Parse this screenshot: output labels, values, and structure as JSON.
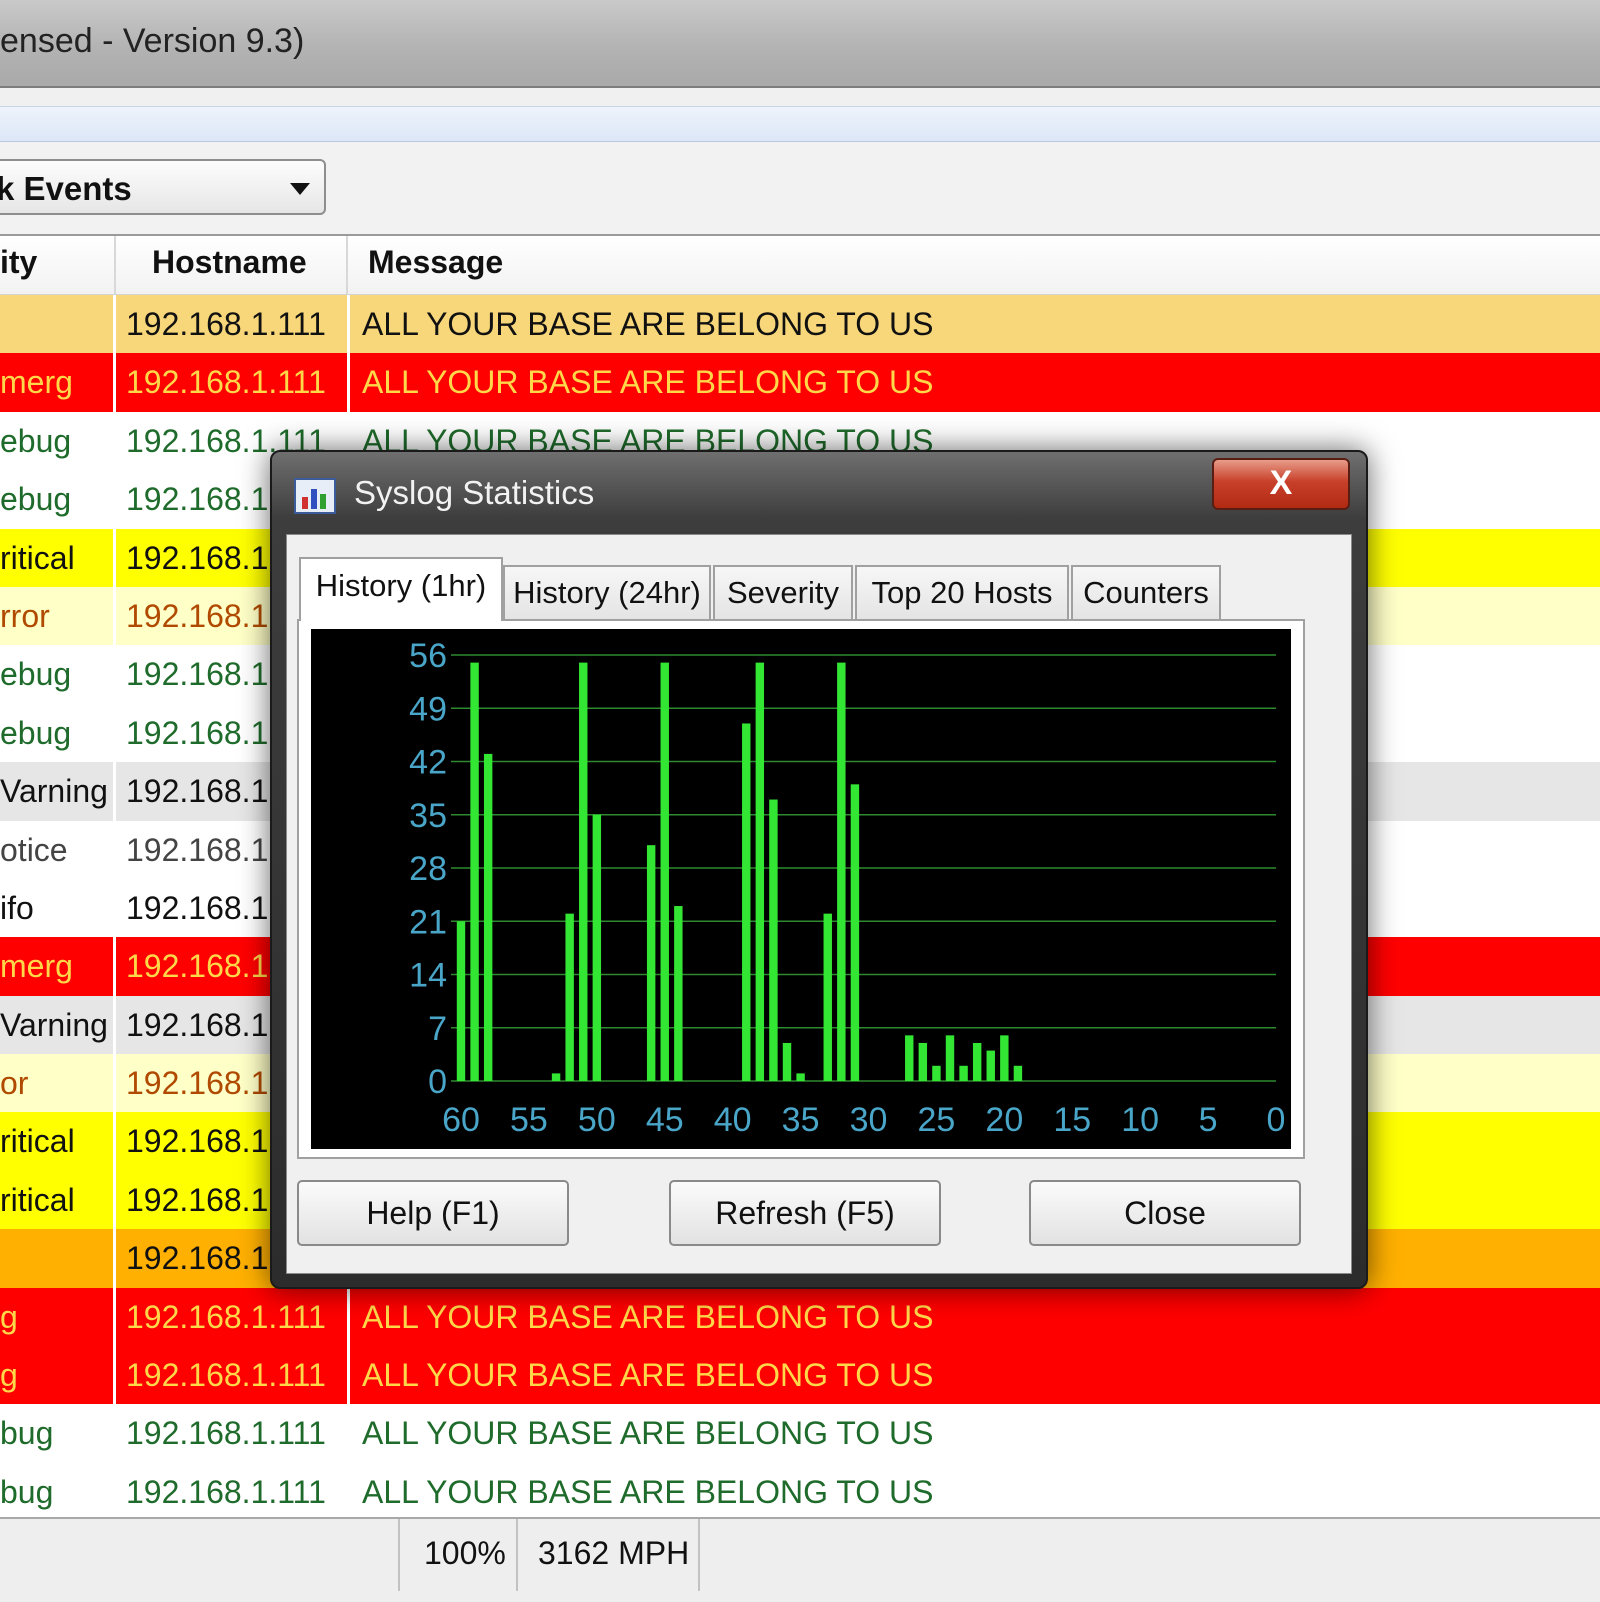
{
  "window": {
    "title": "ensed - Version 9.3)"
  },
  "toolbar": {
    "filter_value": "k Events"
  },
  "grid": {
    "headers": {
      "severity": "ity",
      "hostname": "Hostname",
      "message": "Message"
    },
    "rows": [
      {
        "sev": "",
        "host": "192.168.1.111",
        "msg": "ALL YOUR BASE ARE BELONG TO US",
        "bg": "#f7d77a",
        "fg": "#111111",
        "sevbg": "#f7d77a"
      },
      {
        "sev": "merg",
        "host": "192.168.1.111",
        "msg": "ALL YOUR BASE ARE BELONG TO US",
        "bg": "#ff0000",
        "fg": "#ffd84a",
        "sevbg": "#ff0000"
      },
      {
        "sev": "ebug",
        "host": "192.168.1.111",
        "msg": "ALL YOUR BASE ARE BELONG TO US",
        "bg": "#ffffff",
        "fg": "#1f6b2b",
        "sevbg": "#ffffff"
      },
      {
        "sev": "ebug",
        "host": "192.168.1",
        "msg": "",
        "bg": "#ffffff",
        "fg": "#1f6b2b",
        "sevbg": "#ffffff"
      },
      {
        "sev": "ritical",
        "host": "192.168.1",
        "msg": "",
        "bg": "#ffff00",
        "fg": "#111111",
        "sevbg": "#ffff00"
      },
      {
        "sev": "rror",
        "host": "192.168.1",
        "msg": "",
        "bg": "#ffffc8",
        "fg": "#b04a00",
        "sevbg": "#ffffc8"
      },
      {
        "sev": "ebug",
        "host": "192.168.1",
        "msg": "",
        "bg": "#ffffff",
        "fg": "#1f6b2b",
        "sevbg": "#ffffff"
      },
      {
        "sev": "ebug",
        "host": "192.168.1",
        "msg": "",
        "bg": "#ffffff",
        "fg": "#1f6b2b",
        "sevbg": "#ffffff"
      },
      {
        "sev": "Varning",
        "host": "192.168.1",
        "msg": "",
        "bg": "#e6e6e6",
        "fg": "#111111",
        "sevbg": "#e6e6e6"
      },
      {
        "sev": "otice",
        "host": "192.168.1",
        "msg": "",
        "bg": "#ffffff",
        "fg": "#444444",
        "sevbg": "#ffffff"
      },
      {
        "sev": "ifo",
        "host": "192.168.1",
        "msg": "",
        "bg": "#ffffff",
        "fg": "#111111",
        "sevbg": "#ffffff"
      },
      {
        "sev": "merg",
        "host": "192.168.1",
        "msg": "",
        "bg": "#ff0000",
        "fg": "#ffd84a",
        "sevbg": "#ff0000"
      },
      {
        "sev": "Varning",
        "host": "192.168.1",
        "msg": "",
        "bg": "#e6e6e6",
        "fg": "#111111",
        "sevbg": "#e6e6e6"
      },
      {
        "sev": "or",
        "host": "192.168.1",
        "msg": "",
        "bg": "#ffffc8",
        "fg": "#b04a00",
        "sevbg": "#ffffc8"
      },
      {
        "sev": "ritical",
        "host": "192.168.1",
        "msg": "",
        "bg": "#ffff00",
        "fg": "#111111",
        "sevbg": "#ffff00"
      },
      {
        "sev": "ritical",
        "host": "192.168.1",
        "msg": "",
        "bg": "#ffff00",
        "fg": "#111111",
        "sevbg": "#ffff00"
      },
      {
        "sev": "",
        "host": "192.168.1",
        "msg": "",
        "bg": "#ffb000",
        "fg": "#111111",
        "sevbg": "#ffb000"
      },
      {
        "sev": "g",
        "host": "192.168.1.111",
        "msg": "ALL YOUR BASE ARE BELONG TO US",
        "bg": "#ff0000",
        "fg": "#ffd84a",
        "sevbg": "#ff0000"
      },
      {
        "sev": "g",
        "host": "192.168.1.111",
        "msg": "ALL YOUR BASE ARE BELONG TO US",
        "bg": "#ff0000",
        "fg": "#ffd84a",
        "sevbg": "#ff0000"
      },
      {
        "sev": "bug",
        "host": "192.168.1.111",
        "msg": "ALL YOUR BASE ARE BELONG TO US",
        "bg": "#ffffff",
        "fg": "#1f6b2b",
        "sevbg": "#ffffff"
      },
      {
        "sev": "bug",
        "host": "192.168.1.111",
        "msg": "ALL YOUR BASE ARE BELONG TO US",
        "bg": "#ffffff",
        "fg": "#1f6b2b",
        "sevbg": "#ffffff"
      }
    ]
  },
  "statusbar": {
    "percent": "100%",
    "rate": "3162 MPH"
  },
  "dialog": {
    "title": "Syslog Statistics",
    "close_glyph": "X",
    "tabs": [
      "History (1hr)",
      "History (24hr)",
      "Severity",
      "Top 20 Hosts",
      "Counters"
    ],
    "active_tab": 0,
    "buttons": {
      "help": "Help (F1)",
      "refresh": "Refresh (F5)",
      "close": "Close"
    }
  },
  "chart_data": {
    "type": "bar",
    "x_ticks": [
      60,
      55,
      50,
      45,
      40,
      35,
      30,
      25,
      20,
      15,
      10,
      5,
      0
    ],
    "y_ticks": [
      0,
      7,
      14,
      21,
      28,
      35,
      42,
      49,
      56
    ],
    "ylim": [
      0,
      56
    ],
    "xlim": [
      60,
      0
    ],
    "grid": true,
    "bar_color": "#33e633",
    "background": "#000000",
    "tick_color": "#4aa6c8",
    "values": [
      {
        "x": 60,
        "y": 21
      },
      {
        "x": 59,
        "y": 55
      },
      {
        "x": 58,
        "y": 43
      },
      {
        "x": 53,
        "y": 1
      },
      {
        "x": 52,
        "y": 22
      },
      {
        "x": 51,
        "y": 55
      },
      {
        "x": 50,
        "y": 35
      },
      {
        "x": 46,
        "y": 31
      },
      {
        "x": 45,
        "y": 55
      },
      {
        "x": 44,
        "y": 23
      },
      {
        "x": 39,
        "y": 47
      },
      {
        "x": 38,
        "y": 55
      },
      {
        "x": 37,
        "y": 37
      },
      {
        "x": 36,
        "y": 5
      },
      {
        "x": 35,
        "y": 1
      },
      {
        "x": 33,
        "y": 22
      },
      {
        "x": 32,
        "y": 55
      },
      {
        "x": 31,
        "y": 39
      },
      {
        "x": 27,
        "y": 6
      },
      {
        "x": 26,
        "y": 5
      },
      {
        "x": 25,
        "y": 2
      },
      {
        "x": 24,
        "y": 6
      },
      {
        "x": 23,
        "y": 2
      },
      {
        "x": 22,
        "y": 5
      },
      {
        "x": 21,
        "y": 4
      },
      {
        "x": 20,
        "y": 6
      },
      {
        "x": 19,
        "y": 2
      }
    ]
  }
}
